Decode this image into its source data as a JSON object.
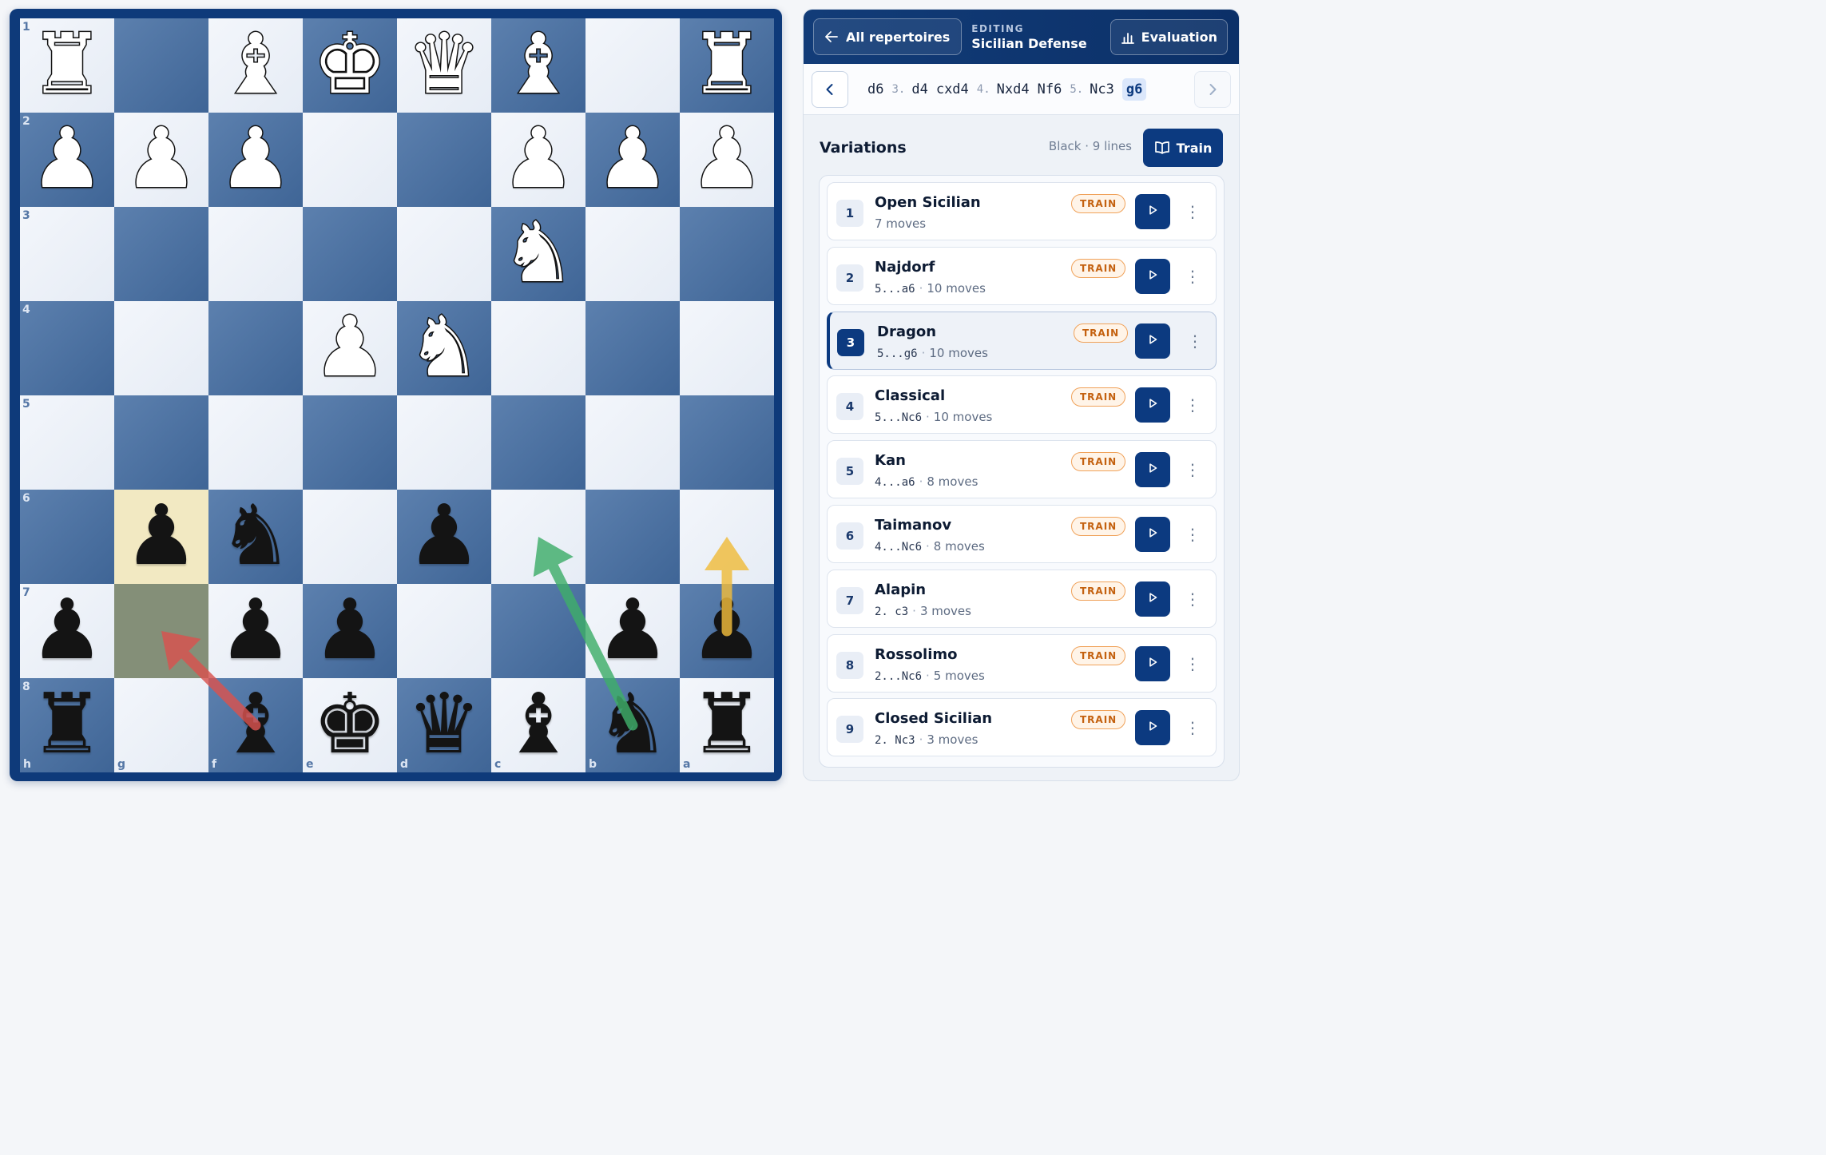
{
  "board": {
    "ranks": [
      "1",
      "2",
      "3",
      "4",
      "5",
      "6",
      "7",
      "8"
    ],
    "files": [
      "h",
      "g",
      "f",
      "e",
      "d",
      "c",
      "b",
      "a"
    ],
    "position": [
      [
        "wR",
        "",
        "wB",
        "wK",
        "wQ",
        "wB",
        "",
        "wR"
      ],
      [
        "wP",
        "wP",
        "wP",
        "",
        "",
        "wP",
        "wP",
        "wP"
      ],
      [
        "",
        "",
        "",
        "",
        "",
        "wN",
        "",
        ""
      ],
      [
        "",
        "",
        "",
        "wP",
        "wN",
        "",
        "",
        ""
      ],
      [
        "",
        "",
        "",
        "",
        "",
        "",
        "",
        ""
      ],
      [
        "",
        "bP",
        "bN",
        "",
        "bP",
        "",
        "",
        ""
      ],
      [
        "bP",
        "",
        "bP",
        "bP",
        "",
        "",
        "bP",
        "bP"
      ],
      [
        "bR",
        "",
        "bB",
        "bK",
        "bQ",
        "bB",
        "bN",
        "bR"
      ]
    ],
    "highlights": {
      "last_move_to": "g6",
      "last_move_from": "g7"
    },
    "arrows": [
      {
        "from": "f8",
        "to": "g7",
        "color": "#d9534f"
      },
      {
        "from": "b8",
        "to": "c6",
        "color": "#3fae6a"
      },
      {
        "from": "a7",
        "to": "a6",
        "color": "#f0bc3c"
      }
    ]
  },
  "header": {
    "back_label": "All repertoires",
    "editing_label": "EDITING",
    "repertoire_name": "Sicilian Defense",
    "evaluation_label": "Evaluation"
  },
  "moves": [
    {
      "text": "d6",
      "type": "move"
    },
    {
      "text": "3.",
      "type": "num"
    },
    {
      "text": "d4",
      "type": "move"
    },
    {
      "text": "cxd4",
      "type": "move"
    },
    {
      "text": "4.",
      "type": "num"
    },
    {
      "text": "Nxd4",
      "type": "move"
    },
    {
      "text": "Nf6",
      "type": "move"
    },
    {
      "text": "5.",
      "type": "num"
    },
    {
      "text": "Nc3",
      "type": "move"
    },
    {
      "text": "g6",
      "type": "current"
    }
  ],
  "variations": {
    "title": "Variations",
    "meta": "Black · 9 lines",
    "train_label": "Train",
    "tag_label": "TRAIN",
    "items": [
      {
        "num": "1",
        "name": "Open Sicilian",
        "key": "",
        "count": "7 moves"
      },
      {
        "num": "2",
        "name": "Najdorf",
        "key": "5...a6",
        "count": "10 moves"
      },
      {
        "num": "3",
        "name": "Dragon",
        "key": "5...g6",
        "count": "10 moves",
        "active": true
      },
      {
        "num": "4",
        "name": "Classical",
        "key": "5...Nc6",
        "count": "10 moves"
      },
      {
        "num": "5",
        "name": "Kan",
        "key": "4...a6",
        "count": "8 moves"
      },
      {
        "num": "6",
        "name": "Taimanov",
        "key": "4...Nc6",
        "count": "8 moves"
      },
      {
        "num": "7",
        "name": "Alapin",
        "key": "2. c3",
        "count": "3 moves"
      },
      {
        "num": "8",
        "name": "Rossolimo",
        "key": "2...Nc6",
        "count": "5 moves"
      },
      {
        "num": "9",
        "name": "Closed Sicilian",
        "key": "2. Nc3",
        "count": "3 moves"
      }
    ]
  },
  "colors": {
    "brand": "#0c3a80",
    "tag": "#c4610f"
  }
}
